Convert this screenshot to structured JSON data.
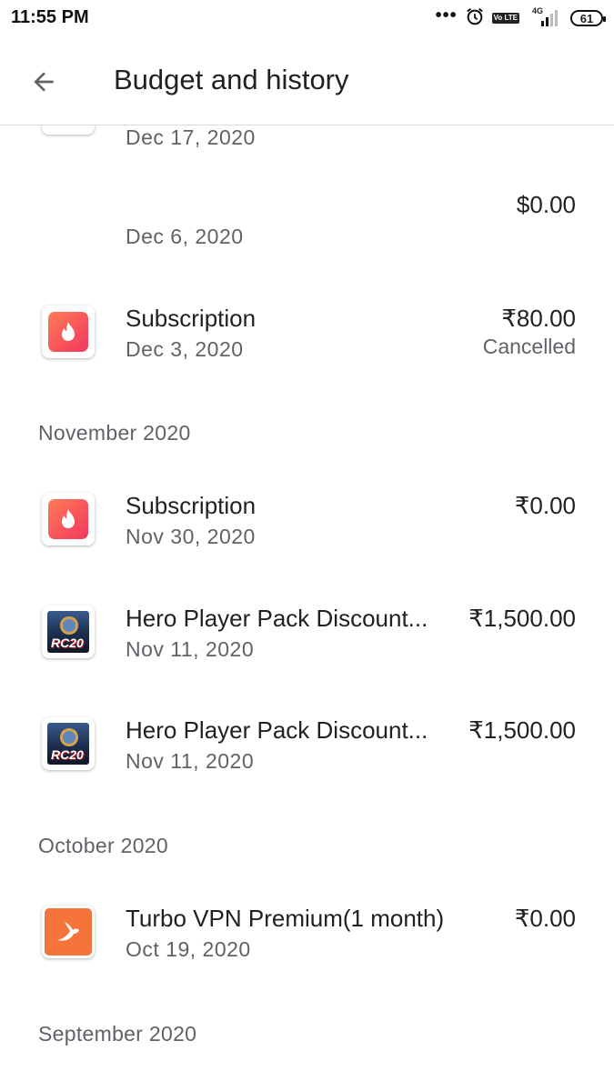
{
  "status_bar": {
    "time": "11:55 PM",
    "dots": "•••",
    "volte": "Vo LTE",
    "network": "4G",
    "battery": "61"
  },
  "app_bar": {
    "title": "Budget and history"
  },
  "cut_off_row": {
    "date": "Dec 17, 2020"
  },
  "december_items": [
    {
      "title": "",
      "date": "Dec 6, 2020",
      "amount": "$0.00",
      "status": "",
      "icon": "none"
    },
    {
      "title": "Subscription",
      "date": "Dec 3, 2020",
      "amount": "₹80.00",
      "status": "Cancelled",
      "icon": "tinder-flame-icon"
    }
  ],
  "sections": [
    {
      "header": "November 2020",
      "items": [
        {
          "title": "Subscription",
          "date": "Nov 30, 2020",
          "amount": "₹0.00",
          "icon": "tinder-flame-icon"
        },
        {
          "title": "Hero Player Pack Discount...",
          "date": "Nov 11, 2020",
          "amount": "₹1,500.00",
          "icon": "real-cricket-20-icon"
        },
        {
          "title": "Hero Player Pack Discount...",
          "date": "Nov 11, 2020",
          "amount": "₹1,500.00",
          "icon": "real-cricket-20-icon"
        }
      ]
    },
    {
      "header": "October 2020",
      "items": [
        {
          "title": "Turbo VPN Premium(1 month)",
          "date": "Oct 19, 2020",
          "amount": "₹0.00",
          "icon": "turbo-vpn-rabbit-icon"
        }
      ]
    },
    {
      "header": "September 2020",
      "items": []
    }
  ],
  "icon_badge_text": "RC20",
  "colors": {
    "primary_text": "#202124",
    "secondary_text": "#5f6368",
    "tinder_gradient_start": "#fd7c57",
    "tinder_gradient_end": "#ef3a60",
    "vpn_orange": "#f4743c"
  }
}
